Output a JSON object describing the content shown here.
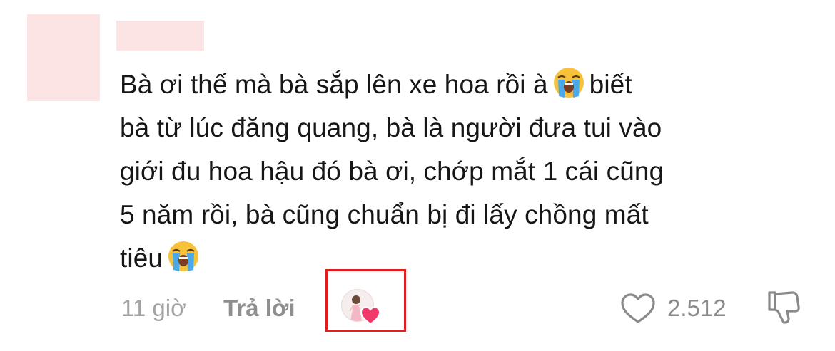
{
  "comment": {
    "lines": [
      "Bà ơi thế mà bà sắp lên xe hoa rồi à",
      "biết",
      "bà từ lúc đăng quang, bà là người đưa tui vào",
      "giới đu hoa hậu đó bà ơi, chớp mắt 1 cái cũng",
      "5 năm rồi, bà cũng chuẩn bị đi lấy chồng mất",
      "tiêu"
    ],
    "emoji_icon": "loudly-crying-face-icon"
  },
  "meta": {
    "time": "11 giờ",
    "reply_label": "Trả lời",
    "like_count": "2.512"
  },
  "icons": {
    "like": "heart-outline-icon",
    "dislike": "thumbs-down-icon",
    "creator_liked": "creator-heart-icon"
  },
  "colors": {
    "highlight_box": "#e11d1d",
    "heart": "#f23a6a",
    "redaction": "#fde4e4"
  }
}
